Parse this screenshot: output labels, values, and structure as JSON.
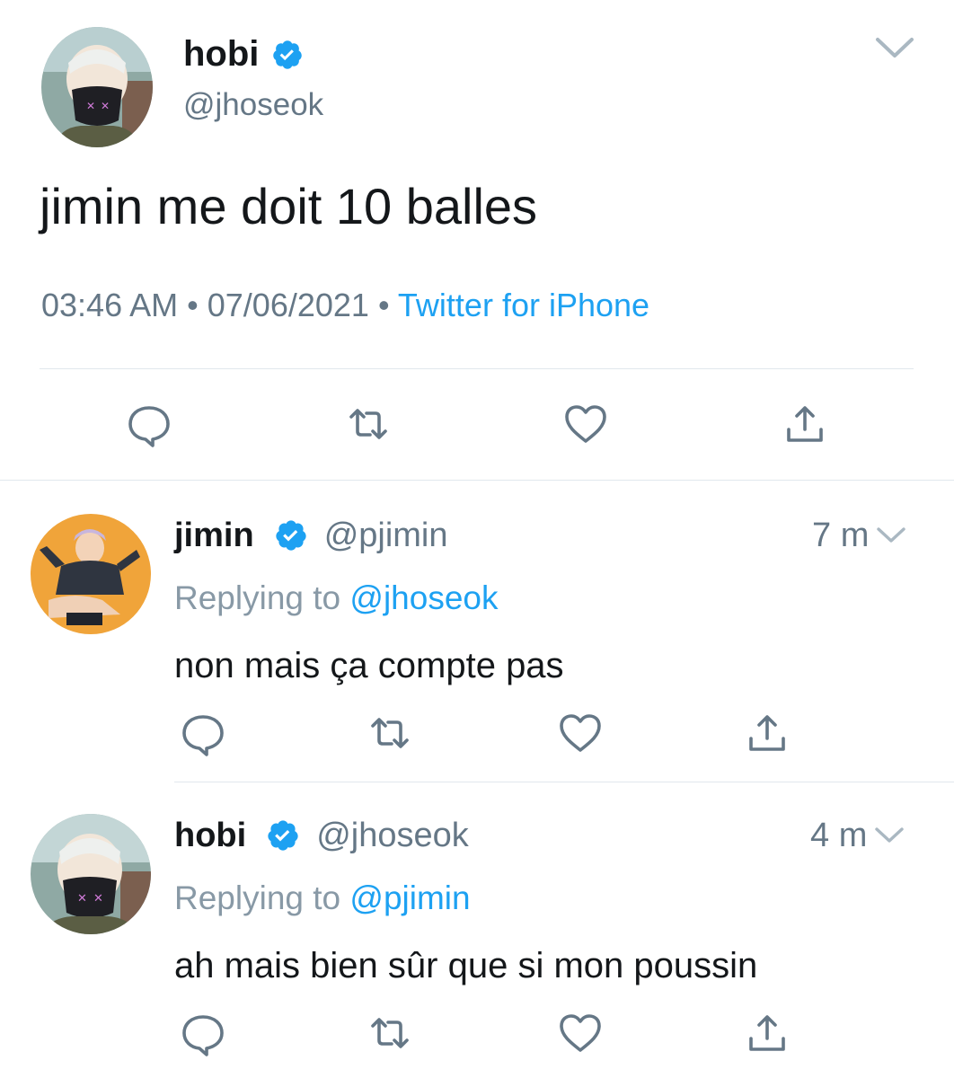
{
  "colors": {
    "text": "#14171a",
    "secondary": "#657786",
    "link": "#1da1f2",
    "verified": "#1da1f2",
    "divider": "#e1e8ed",
    "icon": "#657786"
  },
  "main_tweet": {
    "display_name": "hobi",
    "handle": "@jhoseok",
    "verified": true,
    "text": "jimin me doit 10 balles",
    "time": "03:46 AM",
    "separator": "•",
    "date": "07/06/2021",
    "source": "Twitter for iPhone",
    "actions": [
      "reply-icon",
      "retweet-icon",
      "like-icon",
      "share-icon"
    ]
  },
  "replies": [
    {
      "display_name": "jimin",
      "handle": "@pjimin",
      "verified": true,
      "time_ago": "7 m",
      "replying_prefix": "Replying to",
      "replying_to": "@jhoseok",
      "text": "non mais ça compte pas"
    },
    {
      "display_name": "hobi",
      "handle": "@jhoseok",
      "verified": true,
      "time_ago": "4 m",
      "replying_prefix": "Replying to",
      "replying_to": "@pjimin",
      "text": "ah mais bien sûr que si mon poussin"
    }
  ]
}
